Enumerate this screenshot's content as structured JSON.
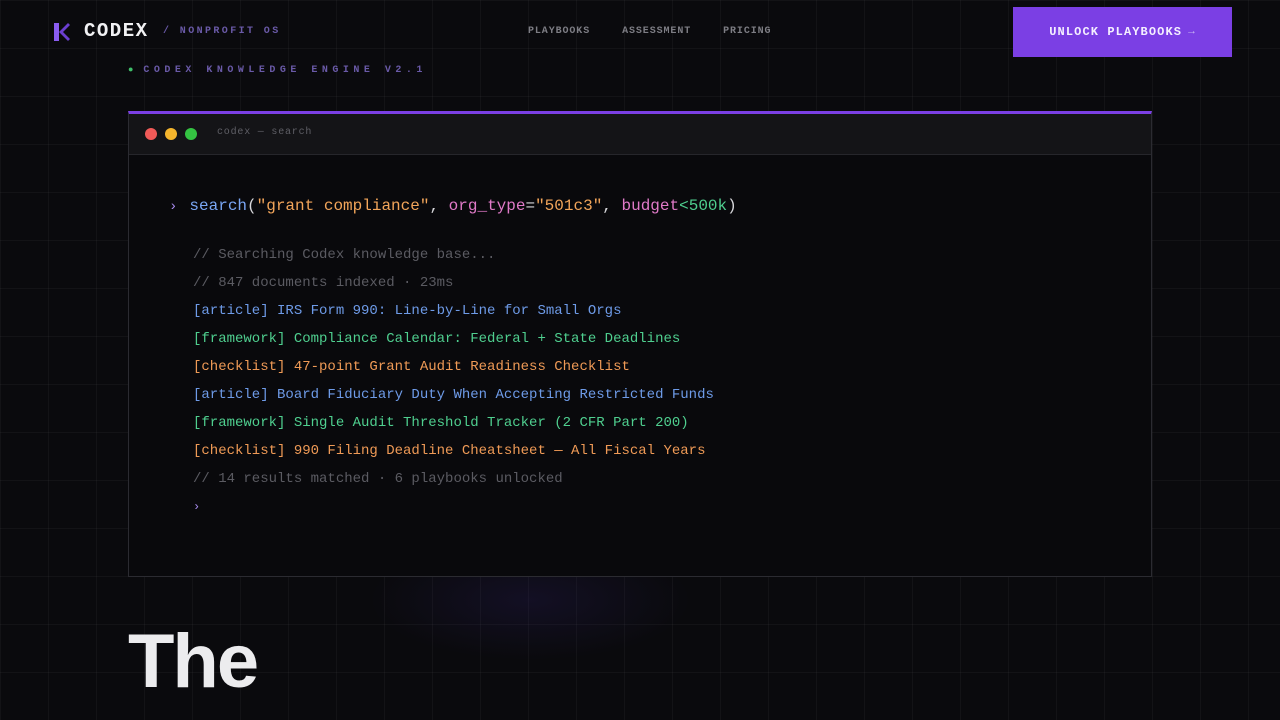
{
  "nav": {
    "brand": "CODEX",
    "brand_sub": "/ NONPROFIT OS",
    "links": [
      "PLAYBOOKS",
      "ASSESSMENT",
      "PRICING"
    ],
    "cta_label": "UNLOCK PLAYBOOKS",
    "cta_arrow": "→"
  },
  "engine_label": "CODEX KNOWLEDGE ENGINE V2.1",
  "terminal": {
    "title": "codex — search",
    "command": {
      "prompt": "›",
      "fn": "search",
      "arg1": "\"grant compliance\"",
      "kw1": "org_type",
      "arg2": "\"501c3\"",
      "kw2": "budget",
      "op": "<500k"
    },
    "lines": [
      {
        "type": "comment",
        "text": "// Searching Codex knowledge base..."
      },
      {
        "type": "comment",
        "text": "// 847 documents indexed · 23ms"
      },
      {
        "type": "article",
        "text": "[article] IRS Form 990: Line-by-Line for Small Orgs"
      },
      {
        "type": "framework",
        "text": "[framework] Compliance Calendar: Federal + State Deadlines"
      },
      {
        "type": "checklist",
        "text": "[checklist] 47-point Grant Audit Readiness Checklist"
      },
      {
        "type": "article",
        "text": "[article] Board Fiduciary Duty When Accepting Restricted Funds"
      },
      {
        "type": "framework",
        "text": "[framework] Single Audit Threshold Tracker (2 CFR Part 200)"
      },
      {
        "type": "checklist",
        "text": "[checklist] 990 Filing Deadline Cheatsheet — All Fiscal Years"
      },
      {
        "type": "comment",
        "text": "// 14 results matched · 6 playbooks unlocked"
      }
    ],
    "cursor_prompt": "›"
  },
  "hero": {
    "line1": "The"
  },
  "colors": {
    "accent": "#7b3fe4",
    "article": "#6e9be8",
    "framework": "#4fcf8f",
    "checklist": "#ef9a56",
    "comment": "#5b5b62"
  }
}
